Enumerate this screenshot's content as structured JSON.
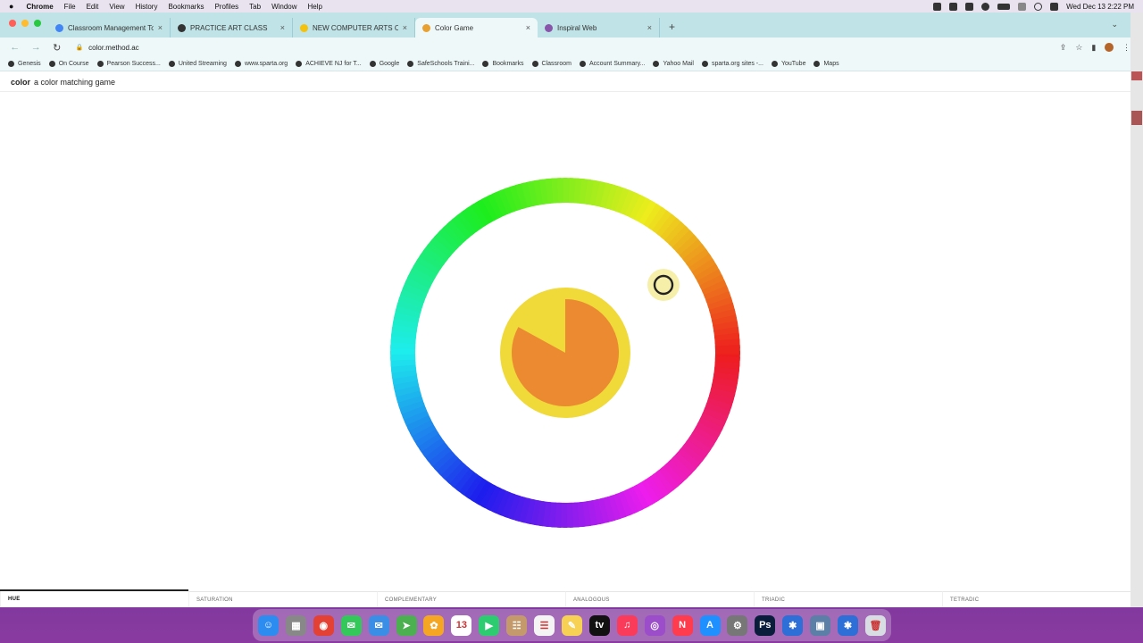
{
  "menubar": {
    "items": [
      "Chrome",
      "File",
      "Edit",
      "View",
      "History",
      "Bookmarks",
      "Profiles",
      "Tab",
      "Window",
      "Help"
    ],
    "clock": "Wed Dec 13  2:22 PM"
  },
  "browser": {
    "tabs": [
      {
        "title": "Classroom Management Tools",
        "icon_color": "#4285f4",
        "icon": "google-icon"
      },
      {
        "title": "PRACTICE ART CLASS",
        "icon_color": "#333333",
        "icon": "classroom-icon"
      },
      {
        "title": "NEW COMPUTER ARTS Choice",
        "icon_color": "#f4c20d",
        "icon": "slides-icon"
      },
      {
        "title": "Color Game",
        "icon_color": "#e8a030",
        "icon": "color-wheel-icon",
        "active": true
      },
      {
        "title": "Inspiral Web",
        "icon_color": "#8855aa",
        "icon": "spiral-icon"
      }
    ],
    "new_tab": "+",
    "url": "color.method.ac",
    "bookmarks": [
      "Genesis",
      "On Course",
      "Pearson Success...",
      "United Streaming",
      "www.sparta.org",
      "ACHIEVE NJ for T...",
      "Google",
      "SafeSchools Traini...",
      "Bookmarks",
      "Classroom",
      "Account Summary...",
      "Yahoo Mail",
      "sparta.org sites -...",
      "YouTube",
      "Maps"
    ]
  },
  "page": {
    "brand": "color",
    "tagline": "a color matching game",
    "target_color": "#f0da3a",
    "user_color": "#ec8a32",
    "user_pie_fraction": 0.83,
    "accent": "#e8a030"
  },
  "modes": [
    {
      "label": "HUE",
      "current": true
    },
    {
      "label": "SATURATION"
    },
    {
      "label": "COMPLEMENTARY"
    },
    {
      "label": "ANALOGOUS"
    },
    {
      "label": "TRIADIC"
    },
    {
      "label": "TETRADIC"
    }
  ],
  "progress_fraction": 0.167,
  "dock": {
    "apps": [
      {
        "name": "finder-icon",
        "color": "#2d8cf0",
        "glyph": "☺"
      },
      {
        "name": "launchpad-icon",
        "color": "#888888",
        "glyph": "▦"
      },
      {
        "name": "chrome-icon",
        "color": "#e34133",
        "glyph": "◉"
      },
      {
        "name": "messages-icon",
        "color": "#34c759",
        "glyph": "✉"
      },
      {
        "name": "mail-icon",
        "color": "#3a8ee6",
        "glyph": "✉"
      },
      {
        "name": "maps-icon",
        "color": "#4caf50",
        "glyph": "➤"
      },
      {
        "name": "photos-icon",
        "color": "#f5a623",
        "glyph": "✿"
      },
      {
        "name": "calendar-icon",
        "color": "#ffffff",
        "glyph": "13"
      },
      {
        "name": "facetime-icon",
        "color": "#2ecc71",
        "glyph": "▶"
      },
      {
        "name": "contacts-icon",
        "color": "#c49a6c",
        "glyph": "☷"
      },
      {
        "name": "reminders-icon",
        "color": "#f4f4f4",
        "glyph": "☰"
      },
      {
        "name": "notes-icon",
        "color": "#f7d154",
        "glyph": "✎"
      },
      {
        "name": "tv-icon",
        "color": "#111111",
        "glyph": "tv"
      },
      {
        "name": "music-icon",
        "color": "#fa3c5a",
        "glyph": "♫"
      },
      {
        "name": "podcasts-icon",
        "color": "#9b4dca",
        "glyph": "◎"
      },
      {
        "name": "news-icon",
        "color": "#ff3b4e",
        "glyph": "N"
      },
      {
        "name": "app-store-icon",
        "color": "#1e90ff",
        "glyph": "A"
      },
      {
        "name": "system-settings-icon",
        "color": "#777777",
        "glyph": "⚙"
      },
      {
        "name": "photoshop-icon",
        "color": "#0a1e3c",
        "glyph": "Ps"
      },
      {
        "name": "self-service-icon",
        "color": "#2d6fd6",
        "glyph": "✱"
      },
      {
        "name": "preview-icon",
        "color": "#5b7fa6",
        "glyph": "▣"
      },
      {
        "name": "self-service-2-icon",
        "color": "#2d6fd6",
        "glyph": "✱"
      },
      {
        "name": "trash-icon",
        "color": "#d8dde3",
        "glyph": "🗑"
      }
    ]
  }
}
